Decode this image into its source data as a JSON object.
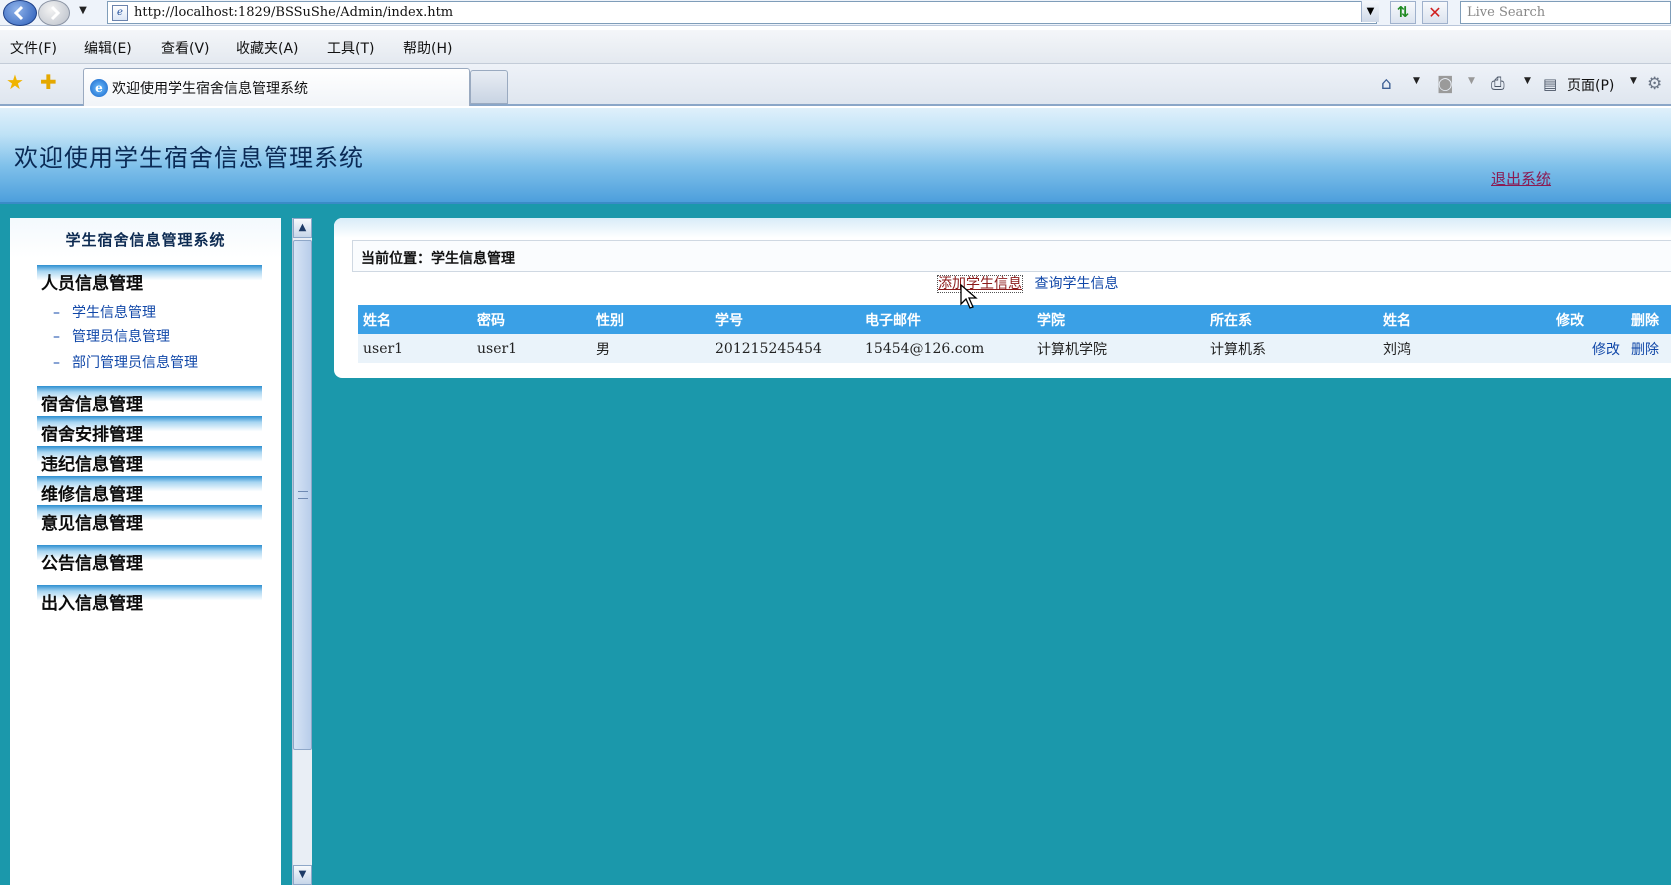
{
  "browser": {
    "address": "http://localhost:1829/BSSuShe/Admin/index.htm",
    "search_placeholder": "Live Search",
    "menu": [
      "文件(F)",
      "编辑(E)",
      "查看(V)",
      "收藏夹(A)",
      "工具(T)",
      "帮助(H)"
    ],
    "tab_title": "欢迎使用学生宿舍信息管理系统",
    "page_menu": "页面(P)"
  },
  "header": {
    "title": "欢迎使用学生宿舍信息管理系统",
    "logout": "退出系统"
  },
  "sidebar": {
    "title": "学生宿舍信息管理系统",
    "categories": [
      "人员信息管理",
      "宿舍信息管理",
      "宿舍安排管理",
      "违纪信息管理",
      "维修信息管理",
      "意见信息管理",
      "公告信息管理",
      "出入信息管理"
    ],
    "sub_items": [
      "学生信息管理",
      "管理员信息管理",
      "部门管理员信息管理"
    ],
    "dash": "–"
  },
  "main": {
    "breadcrumb": "当前位置：学生信息管理",
    "add_link": "添加学生信息",
    "query_link": "查询学生信息",
    "columns": [
      "姓名",
      "密码",
      "性别",
      "学号",
      "电子邮件",
      "学院",
      "所在系",
      "姓名",
      "修改",
      "删除"
    ],
    "rows": [
      [
        "user1",
        "user1",
        "男",
        "201215245454",
        "15454@126.com",
        "计算机学院",
        "计算机系",
        "刘鸿",
        "修改",
        "删除"
      ]
    ]
  },
  "colors": {
    "page_bg": "#1b98ab",
    "table_header": "#3aa0e6",
    "link": "#1047a8",
    "logout": "#8b1a52"
  }
}
